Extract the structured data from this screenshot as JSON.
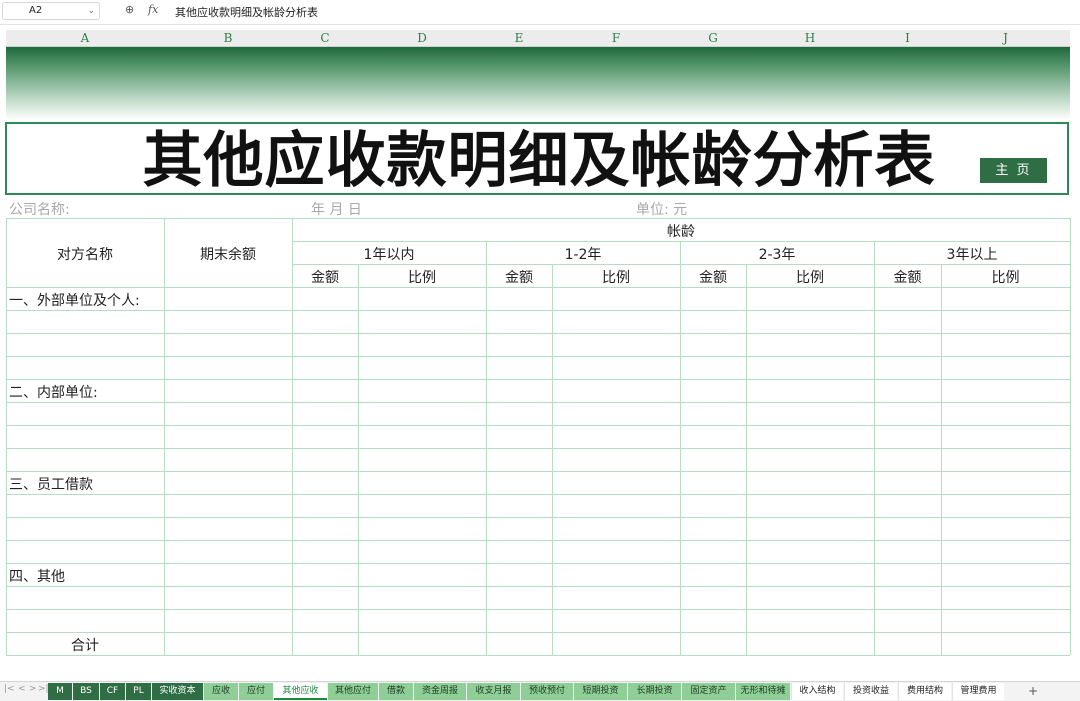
{
  "formula_bar": {
    "cell_ref": "A2",
    "zoom_icon": "⊕",
    "fx_label": "fx",
    "formula": "其他应收款明细及帐龄分析表"
  },
  "columns": [
    "A",
    "B",
    "C",
    "D",
    "E",
    "F",
    "G",
    "H",
    "I",
    "J"
  ],
  "title": "其他应收款明细及帐龄分析表",
  "home_button": "主 页",
  "info": {
    "company_label": "公司名称:",
    "date_label": "年   月   日",
    "unit_label": "单位: 元"
  },
  "table": {
    "col_counterparty": "对方名称",
    "col_balance": "期末余额",
    "aging_header": "帐龄",
    "aging_groups": [
      "1年以内",
      "1-2年",
      "2-3年",
      "3年以上"
    ],
    "sub_amount": "金额",
    "sub_ratio": "比例",
    "sections": [
      "一、外部单位及个人:",
      "二、内部单位:",
      "三、员工借款",
      "四、其他"
    ],
    "total_label": "合计"
  },
  "sheet_tabs": [
    {
      "label": "M",
      "style": "dark"
    },
    {
      "label": "BS",
      "style": "dark"
    },
    {
      "label": "CF",
      "style": "dark"
    },
    {
      "label": "PL",
      "style": "dark"
    },
    {
      "label": "实收资本",
      "style": "dark"
    },
    {
      "label": "应收",
      "style": "light"
    },
    {
      "label": "应付",
      "style": "light"
    },
    {
      "label": "其他应收",
      "style": "active"
    },
    {
      "label": "其他应付",
      "style": "light"
    },
    {
      "label": "借款",
      "style": "light"
    },
    {
      "label": "资金周报",
      "style": "light"
    },
    {
      "label": "收支月报",
      "style": "light"
    },
    {
      "label": "预收预付",
      "style": "light"
    },
    {
      "label": "短期投资",
      "style": "light"
    },
    {
      "label": "长期投资",
      "style": "light"
    },
    {
      "label": "固定资产",
      "style": "light"
    },
    {
      "label": "无形和待摊",
      "style": "light"
    },
    {
      "label": "收入结构",
      "style": "plain"
    },
    {
      "label": "投资收益",
      "style": "plain"
    },
    {
      "label": "费用结构",
      "style": "plain"
    },
    {
      "label": "管理费用",
      "style": "plain"
    }
  ],
  "add_sheet_label": "+",
  "colors": {
    "accent": "#2f6e45",
    "grid": "#b7dcc4",
    "tab_light": "#8fcf97",
    "active_tab_text": "#1c8a3c"
  }
}
